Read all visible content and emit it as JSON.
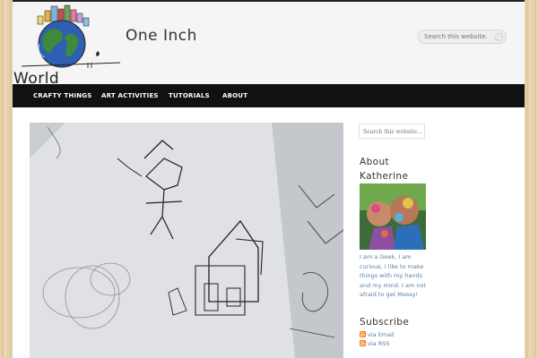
{
  "header": {
    "title_line1": "One Inch",
    "title_line2": "World",
    "search_placeholder": "Search this website..."
  },
  "nav": {
    "items": [
      {
        "label": "CRAFTY THINGS"
      },
      {
        "label": "ART ACTIVITIES"
      },
      {
        "label": "TUTORIALS"
      },
      {
        "label": "ABOUT"
      }
    ]
  },
  "sidebar": {
    "search_placeholder": "Search this website...",
    "about": {
      "title_line1": "About",
      "title_line2": "Katherine",
      "bio": "I am a Geek, I am curious, I like to make things with my hands and my mind. I am not afraid to get Messy!"
    },
    "subscribe": {
      "title": "Subscribe",
      "links": [
        {
          "label": "via Email",
          "icon": "rss-icon"
        },
        {
          "label": "via RSS",
          "icon": "rss-icon"
        }
      ]
    }
  },
  "colors": {
    "nav_bg": "#111111",
    "link": "#5a7fa6",
    "header_bg": "#f5f5f5",
    "feed_icon": "#f58220"
  }
}
